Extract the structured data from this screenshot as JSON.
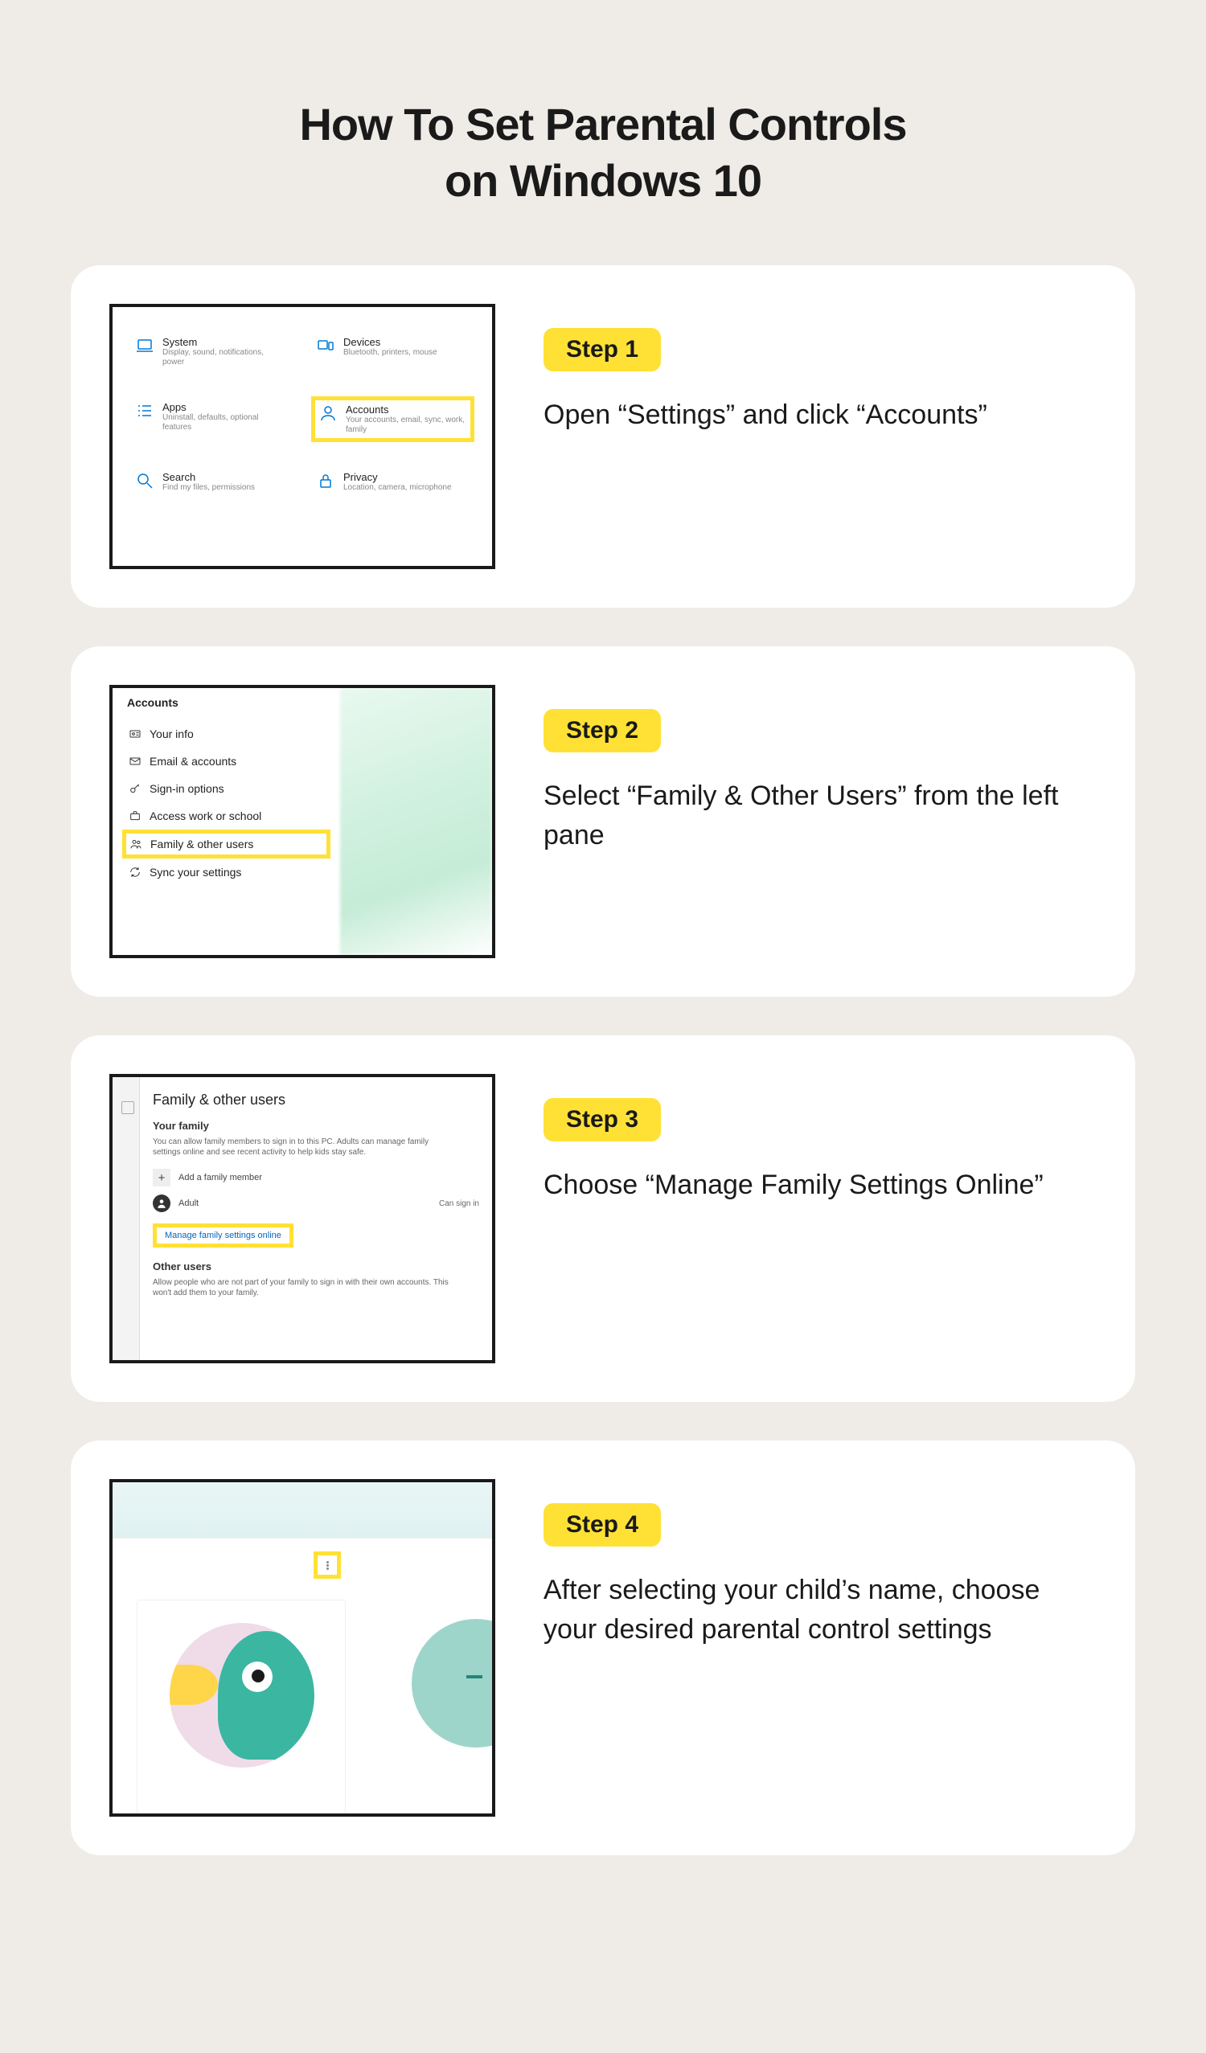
{
  "title_line1": "How To Set Parental Controls",
  "title_line2": "on Windows 10",
  "steps": [
    {
      "badge": "Step 1",
      "text": "Open “Settings” and click “Accounts”"
    },
    {
      "badge": "Step 2",
      "text": "Select “Family & Other Users” from the left pane"
    },
    {
      "badge": "Step 3",
      "text": "Choose “Manage Family Settings Online”"
    },
    {
      "badge": "Step 4",
      "text": "After selecting your child’s name, choose your desired parental control settings"
    }
  ],
  "step1_settings": {
    "system": {
      "title": "System",
      "sub": "Display, sound, notifications, power"
    },
    "devices": {
      "title": "Devices",
      "sub": "Bluetooth, printers, mouse"
    },
    "apps": {
      "title": "Apps",
      "sub": "Uninstall, defaults, optional features"
    },
    "accounts": {
      "title": "Accounts",
      "sub": "Your accounts, email, sync, work, family"
    },
    "search": {
      "title": "Search",
      "sub": "Find my files, permissions"
    },
    "privacy": {
      "title": "Privacy",
      "sub": "Location, camera, microphone"
    }
  },
  "step2_sidebar": {
    "header": "Accounts",
    "items": {
      "your_info": "Your info",
      "email": "Email & accounts",
      "signin": "Sign-in options",
      "work": "Access work or school",
      "family": "Family & other users",
      "sync": "Sync your settings"
    }
  },
  "step3_pane": {
    "heading": "Family & other users",
    "your_family": "Your family",
    "family_desc": "You can allow family members to sign in to this PC. Adults can manage family settings online and see recent activity to help kids stay safe.",
    "add_member": "Add a family member",
    "adult": "Adult",
    "can_sign_in": "Can sign in",
    "manage_link": "Manage family settings online",
    "other_users": "Other users",
    "other_desc": "Allow people who are not part of your family to sign in with their own accounts. This won't add them to your family."
  }
}
